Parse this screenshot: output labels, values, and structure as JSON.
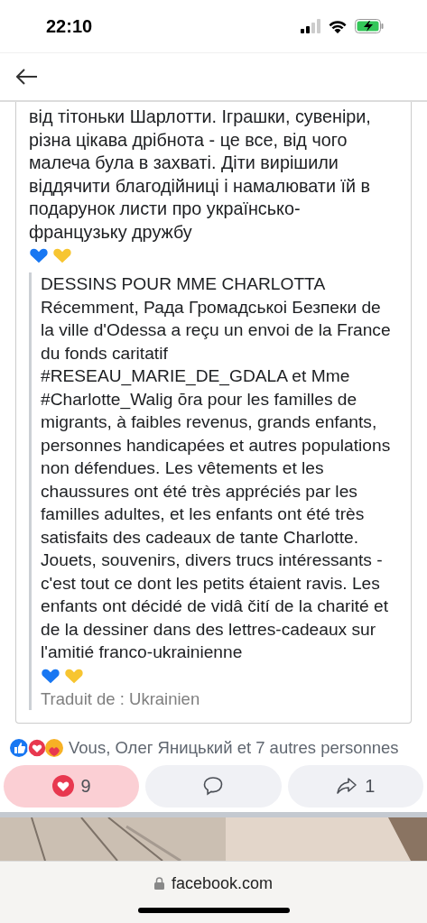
{
  "status_bar": {
    "time": "22:10"
  },
  "post": {
    "text": "від тітоньки Шарлотти. Іграшки, сувеніри, різна цікава дрібнота - це все, від чого малеча була в захваті. Діти вирішили віддячити благодійниці і намалювати їй в подарунок листи про українсько-французьку дружбу",
    "translation": {
      "title": "DESSINS POUR MME CHARLOTTA",
      "text": "Récemment, Рада Громадськоі Безпеки de la ville d'Odessa a reçu un envoi de la France du fonds caritatif #RESEAU_MARIE_DE_GDALA et Mme #Charlotte_Walig ōra pour les familles de migrants, à faibles revenus, grands enfants, personnes handicapées et autres populations non défendues. Les vêtements et les chaussures ont été très appréciés par les familles adultes, et les enfants ont été très satisfaits des cadeaux de tante Charlotte. Jouets, souvenirs, divers trucs intéressants - c'est tout ce dont les petits étaient ravis. Les enfants ont décidé de vidâ čití de la charité et de la dessiner dans des lettres-cadeaux sur l'amitié franco-ukrainienne",
      "note": "Traduit de : Ukrainien"
    }
  },
  "reactions": {
    "summary": "Vous, Олег Яницький et 7 autres personnes"
  },
  "actions": [
    {
      "kind": "love",
      "label": "9",
      "selected": true
    },
    {
      "kind": "comment",
      "selected": false
    },
    {
      "kind": "share",
      "label": "1",
      "selected": false
    }
  ],
  "browser": {
    "url": "facebook.com"
  }
}
